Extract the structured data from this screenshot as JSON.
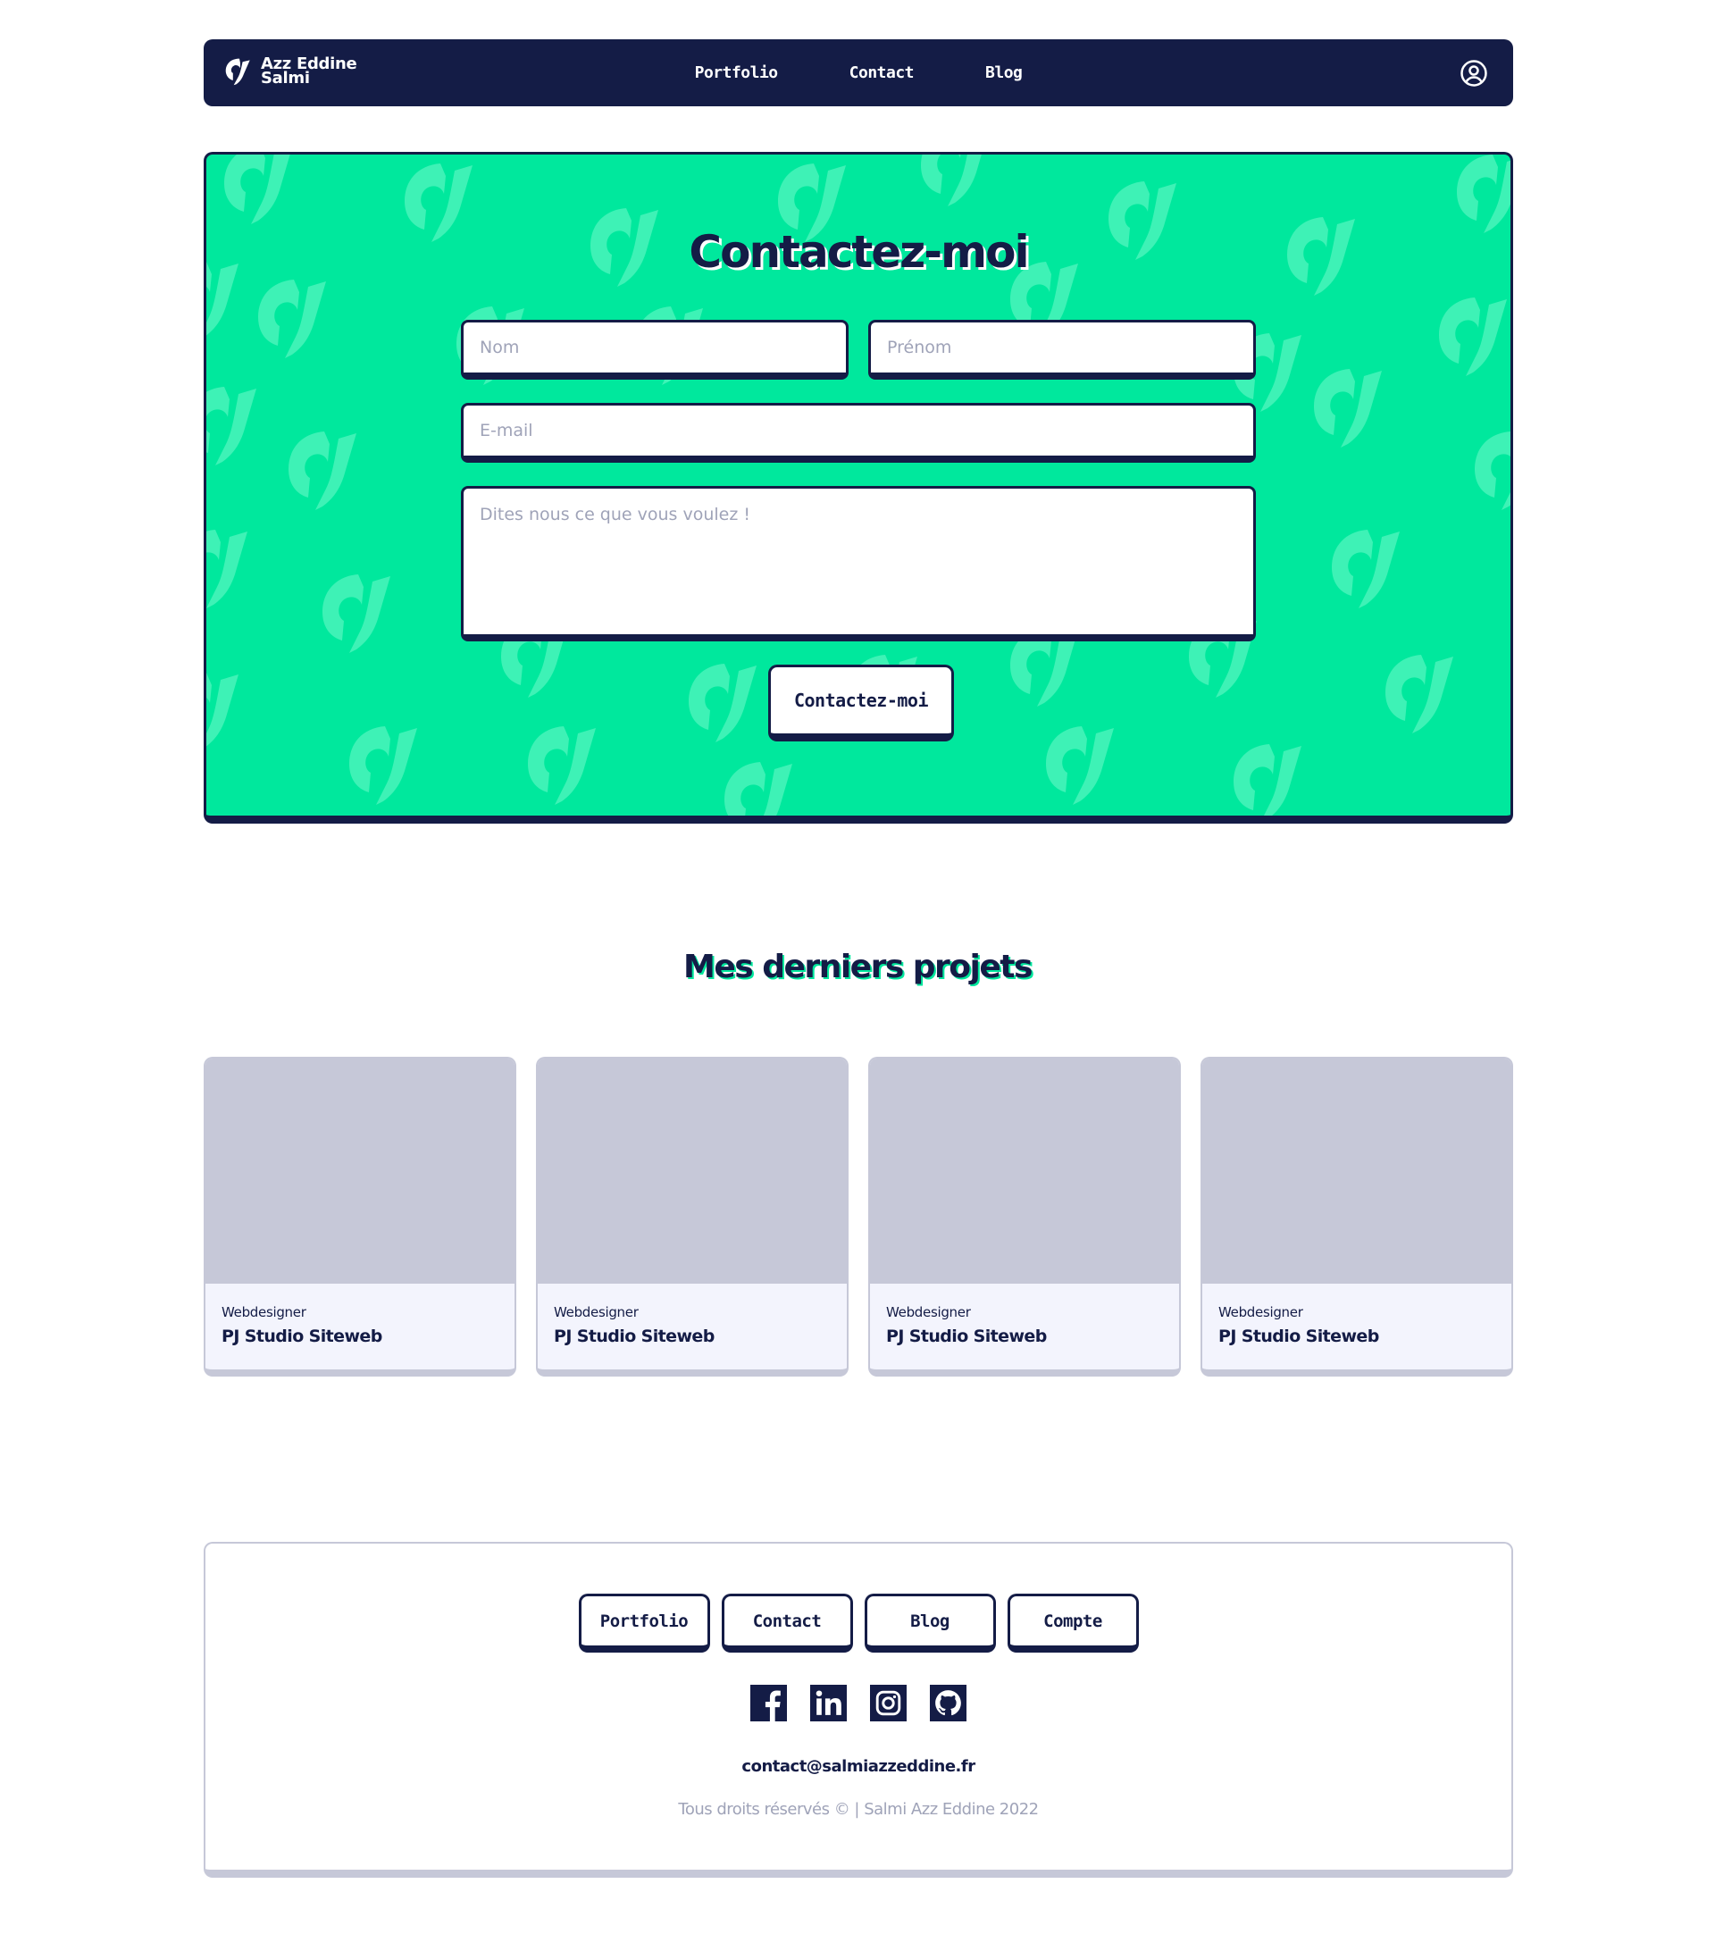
{
  "colors": {
    "navy": "#141c46",
    "accent": "#00e89d",
    "muted": "#c6c8d8",
    "placeholder": "#9fa3b8"
  },
  "header": {
    "brand_line1": "Azz Eddine",
    "brand_line2": "Salmi",
    "brand_icon": "logo-mark",
    "nav": [
      {
        "label": "Portfolio"
      },
      {
        "label": "Contact"
      },
      {
        "label": "Blog"
      }
    ],
    "account_icon": "user-circle-icon"
  },
  "contact": {
    "title": "Contactez-moi",
    "nom_placeholder": "Nom",
    "prenom_placeholder": "Prénom",
    "email_placeholder": "E-mail",
    "message_placeholder": "Dites nous ce que vous voulez !",
    "submit_label": "Contactez-moi"
  },
  "projects": {
    "title": "Mes derniers projets",
    "items": [
      {
        "category": "Webdesigner",
        "title": "PJ Studio Siteweb"
      },
      {
        "category": "Webdesigner",
        "title": "PJ Studio Siteweb"
      },
      {
        "category": "Webdesigner",
        "title": "PJ Studio Siteweb"
      },
      {
        "category": "Webdesigner",
        "title": "PJ Studio Siteweb"
      }
    ]
  },
  "footer": {
    "links": [
      {
        "label": "Portfolio"
      },
      {
        "label": "Contact"
      },
      {
        "label": "Blog"
      },
      {
        "label": "Compte"
      }
    ],
    "socials": [
      "facebook-icon",
      "linkedin-icon",
      "instagram-icon",
      "github-icon"
    ],
    "email": "contact@salmiazzeddine.fr",
    "copyright": "Tous droits réservés © | Salmi Azz Eddine 2022"
  }
}
